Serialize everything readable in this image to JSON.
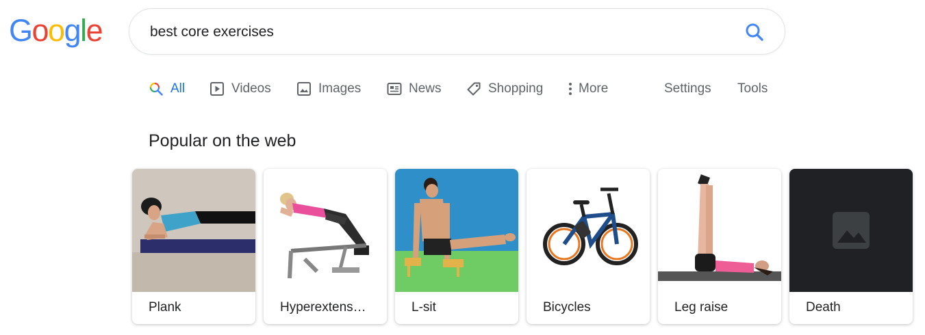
{
  "logo": {
    "letters": [
      "G",
      "o",
      "o",
      "g",
      "l",
      "e"
    ],
    "colors": [
      "#4285f4",
      "#ea4335",
      "#fbbc05",
      "#4285f4",
      "#34a853",
      "#ea4335"
    ]
  },
  "search": {
    "query": "best core exercises",
    "icon": "search-icon"
  },
  "tabs": [
    {
      "label": "All",
      "icon": "search-multicolor-icon",
      "active": true
    },
    {
      "label": "Videos",
      "icon": "play-icon",
      "active": false
    },
    {
      "label": "Images",
      "icon": "image-icon",
      "active": false
    },
    {
      "label": "News",
      "icon": "newspaper-icon",
      "active": false
    },
    {
      "label": "Shopping",
      "icon": "tag-icon",
      "active": false
    },
    {
      "label": "More",
      "icon": "dots-vertical-icon",
      "active": false
    },
    {
      "label": "Settings",
      "active": false
    },
    {
      "label": "Tools",
      "active": false
    }
  ],
  "section": {
    "heading": "Popular on the web"
  },
  "cards": [
    {
      "label": "Plank",
      "icon": "plank-photo"
    },
    {
      "label": "Hyperextens…",
      "icon": "hyperextension-photo"
    },
    {
      "label": "L-sit",
      "icon": "l-sit-photo"
    },
    {
      "label": "Bicycles",
      "icon": "bicycle-photo"
    },
    {
      "label": "Leg raise",
      "icon": "leg-raise-photo"
    },
    {
      "label": "Death",
      "icon": "image-placeholder-icon"
    }
  ],
  "colors": {
    "active_tab": "#1a73e8",
    "inactive_tab": "#5f6368",
    "search_icon": "#4285f4",
    "placeholder_bg": "#202124"
  }
}
